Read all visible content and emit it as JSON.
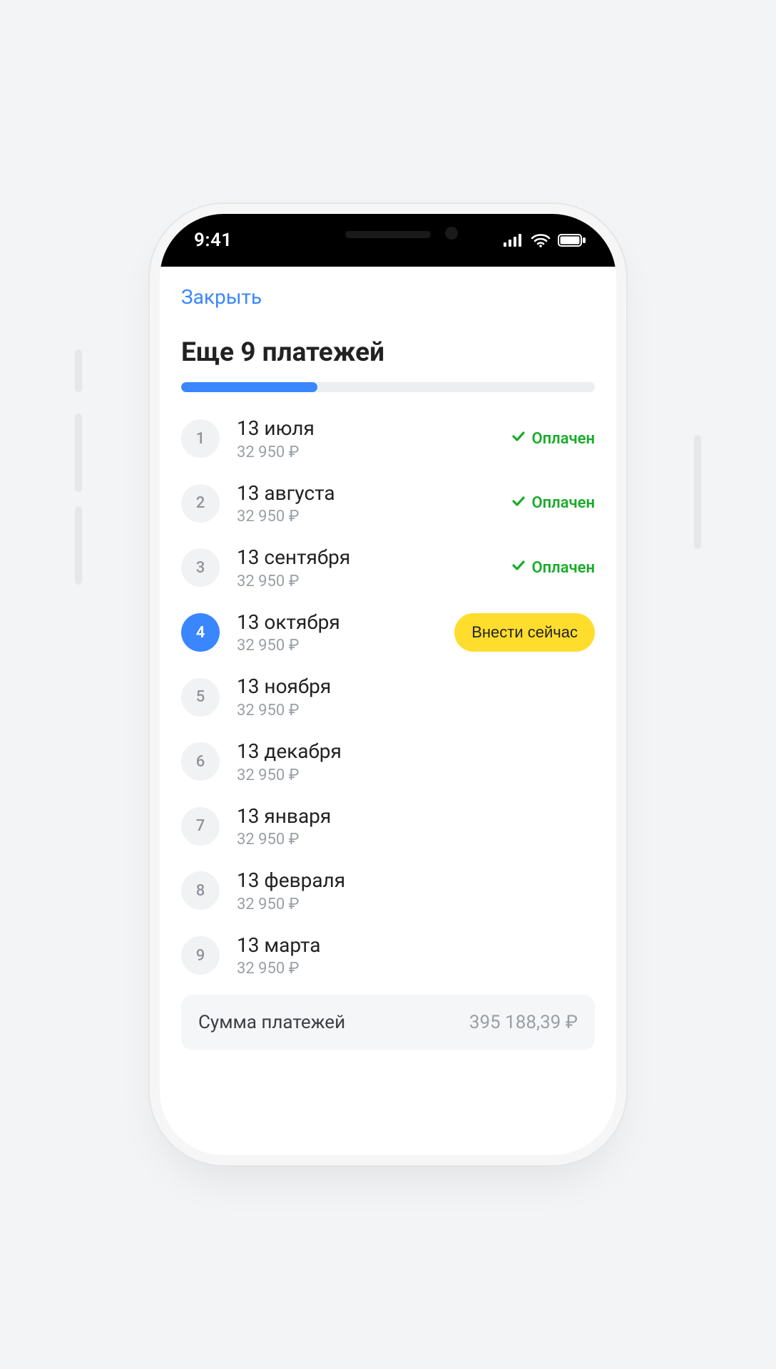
{
  "statusbar": {
    "time": "9:41"
  },
  "nav": {
    "close": "Закрыть"
  },
  "header": {
    "title": "Еще 9 платежей"
  },
  "progress": {
    "percent": 33
  },
  "status": {
    "paid_label": "Оплачен",
    "pay_now_label": "Внести сейчас"
  },
  "payments": [
    {
      "n": "1",
      "date": "13 июля",
      "amount": "32 950 ₽",
      "state": "paid"
    },
    {
      "n": "2",
      "date": "13 августа",
      "amount": "32 950 ₽",
      "state": "paid"
    },
    {
      "n": "3",
      "date": "13 сентября",
      "amount": "32 950 ₽",
      "state": "paid"
    },
    {
      "n": "4",
      "date": "13 октября",
      "amount": "32 950 ₽",
      "state": "current"
    },
    {
      "n": "5",
      "date": "13 ноября",
      "amount": "32 950 ₽",
      "state": "future"
    },
    {
      "n": "6",
      "date": "13 декабря",
      "amount": "32 950 ₽",
      "state": "future"
    },
    {
      "n": "7",
      "date": "13 января",
      "amount": "32 950 ₽",
      "state": "future"
    },
    {
      "n": "8",
      "date": "13 февраля",
      "amount": "32 950 ₽",
      "state": "future"
    },
    {
      "n": "9",
      "date": "13 марта",
      "amount": "32 950 ₽",
      "state": "future"
    }
  ],
  "summary": {
    "label": "Сумма платежей",
    "value": "395 188,39 ₽"
  },
  "colors": {
    "accent": "#3a86ff",
    "success": "#1aab2a",
    "cta": "#ffdd2d"
  }
}
